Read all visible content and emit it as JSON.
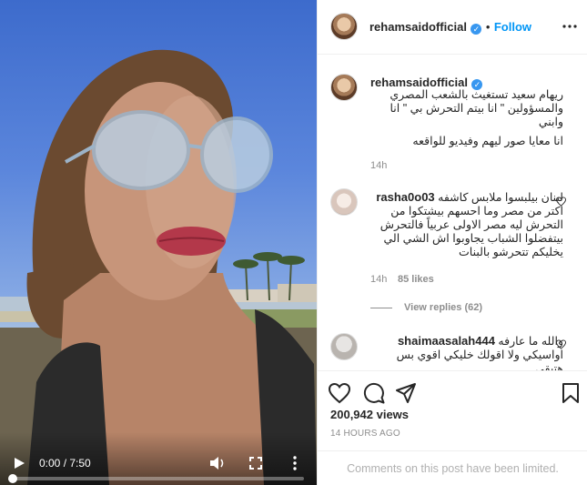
{
  "video": {
    "current_time": "0:00",
    "duration": "7:50",
    "time_separator": " / ",
    "progress": 0.0
  },
  "post": {
    "username": "rehamsaidofficial",
    "verified_mark": "✓",
    "separator": "•",
    "follow_label": "Follow",
    "caption_line1": "ريهام سعيد تستغيث بالشعب المصري والمسؤولين \" انا بيتم التحرش بي \" انا وابني",
    "caption_line2": "انا معايا صور ليهم وفيديو للواقعه",
    "caption_time": "14h"
  },
  "comments": [
    {
      "username": "rasha0o03",
      "text": "لبنان بيلبسوا ملابس كاشفه اكتر من مصر وما احسهم بيشتكوا من التحرش ليه مصر الاولى عربياً فالتحرش بيتفضلوا الشباب يجاوبوا اش الشي الي يخليكم تتحرشو بالبنات",
      "time": "14h",
      "likes": "85 likes",
      "view_replies": "View replies (62)"
    },
    {
      "username": "shaimaasalah444",
      "text": "والله ما عارفه اواسيكي ولا اقولك خليكي اقوي بس هتبقي"
    }
  ],
  "stats": {
    "views": "200,942 views",
    "timestamp": "14 HOURS AGO"
  },
  "footer": {
    "limited_text": "Comments on this post have been limited."
  },
  "colors": {
    "accent": "#0095f6",
    "verified": "#3897f0",
    "muted": "#8e8e8e"
  }
}
